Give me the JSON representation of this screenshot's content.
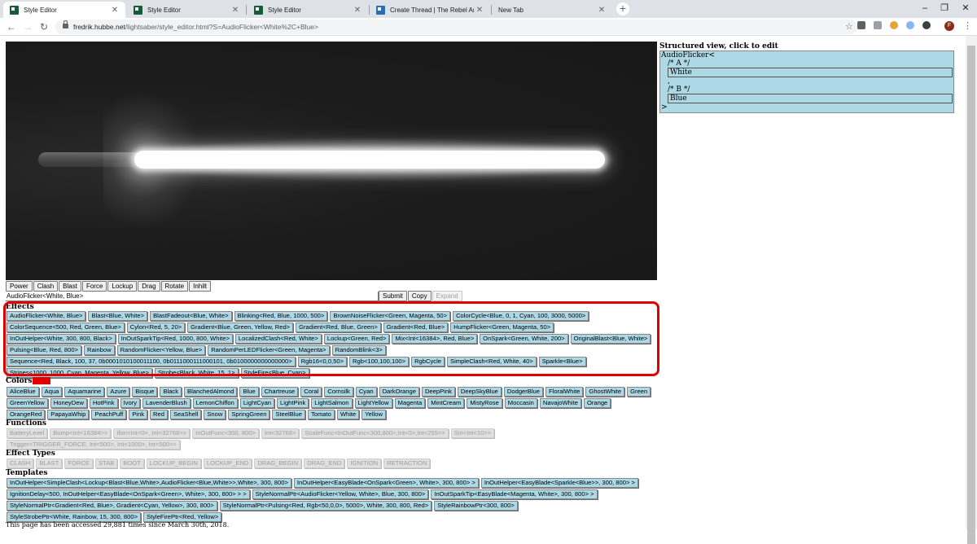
{
  "browser": {
    "tabs": [
      {
        "title": "Style Editor",
        "active": true,
        "favicon": "terminal-green-icon"
      },
      {
        "title": "Style Editor",
        "active": false,
        "favicon": "terminal-green-icon"
      },
      {
        "title": "Style Editor",
        "active": false,
        "favicon": "terminal-green-icon"
      },
      {
        "title": "Create Thread | The Rebel Armor...",
        "active": false,
        "favicon": "forum-blue-icon"
      },
      {
        "title": "New Tab",
        "active": false,
        "favicon": ""
      }
    ],
    "new_tab": "+",
    "url_host": "fredrik.hubbe.net",
    "url_path": "/lightsaber/style_editor.html?S=AudioFlicker<White%2C+Blue>",
    "avatar_letter": "F"
  },
  "toolbar": {
    "buttons": [
      "Power",
      "Clash",
      "Blast",
      "Force",
      "Lockup",
      "Drag",
      "Rotate",
      "Inhilt"
    ],
    "style_input": "AudioFlicker<White, Blue>",
    "submit": "Submit",
    "copy": "Copy",
    "expand": "Expand"
  },
  "sections": {
    "effects_title": "Effects",
    "colors_title": "Colors",
    "functions_title": "Functions",
    "effect_types_title": "Effect Types",
    "templates_title": "Templates"
  },
  "effects": [
    "AudioFlicker<White, Blue>",
    "Blast<Blue, White>",
    "BlastFadeout<Blue, White>",
    "Blinking<Red, Blue, 1000, 500>",
    "BrownNoiseFlicker<Green, Magenta, 50>",
    "ColorCycle<Blue,  0, 1, Cyan,  100, 3000, 5000>",
    "ColorSequence<500, Red, Green, Blue>",
    "Cylon<Red, 5, 20>",
    "Gradient<Blue, Green, Yellow, Red>",
    "Gradient<Red, Blue, Green>",
    "Gradient<Red, Blue>",
    "HumpFlicker<Green, Magenta, 50>",
    "InOutHelper<White, 300, 800, Black>",
    "InOutSparkTip<Red, 1000, 800, White>",
    "LocalizedClash<Red, White>",
    "Lockup<Green, Red>",
    "Mix<Int<16384>, Red, Blue>",
    "OnSpark<Green, White, 200>",
    "OriginalBlast<Blue, White>",
    "Pulsing<Blue, Red, 800>",
    "Rainbow",
    "RandomFlicker<Yellow, Blue>",
    "RandomPerLEDFlicker<Green, Magenta>",
    "RandomBlink<3>",
    "Sequence<Red, Black, 100, 37, 0b0001010100011100, 0b0111000111000101, 0b0100000000000000>",
    "Rgb16<0,0,50>",
    "Rgb<100,100,100>",
    "RgbCycle",
    "SimpleClash<Red, White, 40>",
    "Sparkle<Blue>",
    "Stripes<1000, 1000, Cyan, Magenta, Yellow, Blue>",
    "Strobe<Black, White, 15, 1>",
    "StyleFire<Blue, Cyan>"
  ],
  "colors": [
    "AliceBlue",
    "Aqua",
    "Aquamarine",
    "Azure",
    "Bisque",
    "Black",
    "BlanchedAlmond",
    "Blue",
    "Chartreuse",
    "Coral",
    "Cornsilk",
    "Cyan",
    "DarkOrange",
    "DeepPink",
    "DeepSkyBlue",
    "DodgerBlue",
    "FloralWhite",
    "GhostWhite",
    "Green",
    "GreenYellow",
    "HoneyDew",
    "HotPink",
    "Ivory",
    "LavenderBlush",
    "LemonChiffon",
    "LightCyan",
    "LightPink",
    "LightSalmon",
    "LightYellow",
    "Magenta",
    "MintCream",
    "MistyRose",
    "Moccasin",
    "NavajoWhite",
    "Orange",
    "OrangeRed",
    "PapayaWhip",
    "PeachPuff",
    "Pink",
    "Red",
    "SeaShell",
    "Snow",
    "SpringGreen",
    "SteelBlue",
    "Tomato",
    "White",
    "Yellow"
  ],
  "selected_color": "#e00000",
  "functions": [
    "BatteryLevel",
    "Bump<Int<16384>>",
    "Ifon<Int<0>, Int<32768>>",
    "InOutFunc<300, 800>",
    "Int<32768>",
    "ScaleFunc<InOutFunc<300,800>,Int<0>,Int<255>>",
    "Sin<Int<10>>",
    "Trigger<TRIGGER_FORCE, Int<500>, Int<1000>, Int<500>>"
  ],
  "effect_types": [
    "CLASH",
    "BLAST",
    "FORCE",
    "STAB",
    "BOOT",
    "LOCKUP_BEGIN",
    "LOCKUP_END",
    "DRAG_BEGIN",
    "DRAG_END",
    "IGNITION",
    "RETRACTION"
  ],
  "templates": [
    "InOutHelper<SimpleClash<Lockup<Blast<Blue,White>,AudioFlicker<Blue,White>>,White>, 300, 800>",
    "InOutHelper<EasyBlade<OnSpark<Green>, White>, 300, 800> >",
    "InOutHelper<EasyBlade<Sparkle<Blue>>, 300, 800> >",
    "IgnitionDelay<500, InOutHelper<EasyBlade<OnSpark<Green>, White>, 300, 800> > >",
    "StyleNormalPtr<AudioFlicker<Yellow, White>, Blue, 300, 800>",
    "InOutSparkTip<EasyBlade<Magenta, White>, 300, 800> >",
    "StyleNormalPtr<Gradient<Red, Blue>, Gradient<Cyan, Yellow>, 300, 800>",
    "StyleNormalPtr<Pulsing<Red, Rgb<50,0,0>, 5000>, White, 300, 800, Red>",
    "StyleRainbowPtr<300, 800>",
    "StyleStrobePtr<White, Rainbow, 15, 300, 800>",
    "StyleFirePtr<Red, Yellow>"
  ],
  "footer": "This page has been accessed 29,881 times since March 30th, 2018.",
  "structured_view": {
    "title": "Structured view, click to edit",
    "open": "AudioFlicker<",
    "comment_a": "/* A */",
    "value_a": "White",
    "separator": ",",
    "comment_b": "/* B */",
    "value_b": "Blue",
    "close": ">"
  }
}
